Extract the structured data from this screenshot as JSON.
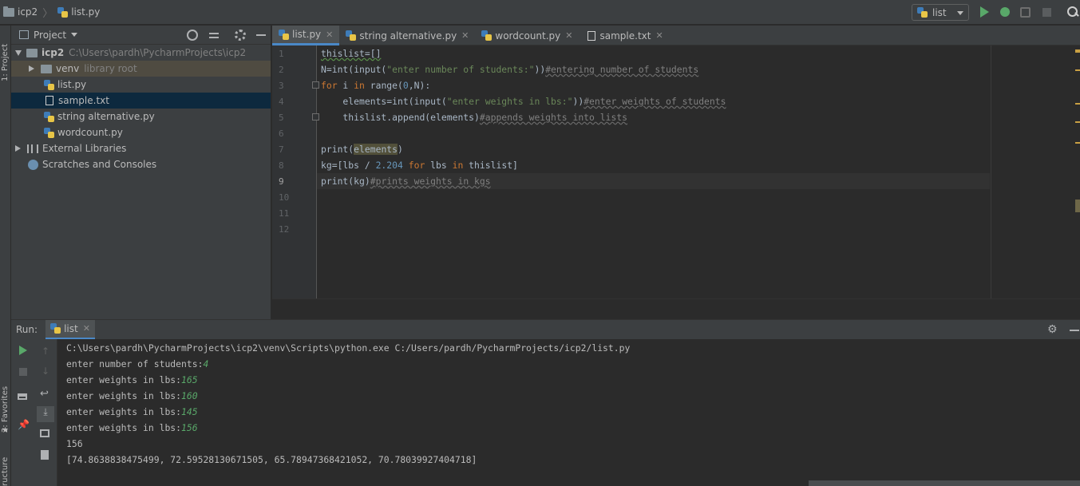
{
  "breadcrumb": {
    "project": "icp2",
    "file": "list.py"
  },
  "run_config": {
    "label": "list"
  },
  "colors": {
    "accent": "#4a88c7",
    "run_green": "#59a869",
    "keyword": "#cc7832",
    "string": "#6a8759",
    "number": "#6897bb",
    "comment": "#808080"
  },
  "left_strip": {
    "project_label": "1: Project",
    "favorites_label": "2: Favorites",
    "structure_label": "ructure"
  },
  "project_panel": {
    "title": "Project",
    "root": {
      "name": "icp2",
      "path": "C:\\Users\\pardh\\PycharmProjects\\icp2"
    },
    "venv": {
      "name": "venv",
      "hint": "library root"
    },
    "files": [
      "list.py",
      "sample.txt",
      "string alternative.py",
      "wordcount.py"
    ],
    "external": "External Libraries",
    "scratches": "Scratches and Consoles"
  },
  "editor_tabs": [
    {
      "label": "list.py",
      "icon": "python-file-icon"
    },
    {
      "label": "string alternative.py",
      "icon": "python-file-icon"
    },
    {
      "label": "wordcount.py",
      "icon": "python-file-icon"
    },
    {
      "label": "sample.txt",
      "icon": "text-file-icon"
    }
  ],
  "editor": {
    "line_numbers": [
      "1",
      "2",
      "3",
      "4",
      "5",
      "6",
      "7",
      "8",
      "9",
      "10",
      "11",
      "12"
    ],
    "current_line": 9,
    "code": [
      "thislist=[]",
      "N=int(input(\"enter number of students:\"))#entering number of students",
      "for i in range(0,N):",
      "    elements=int(input(\"enter weights in lbs:\"))#enter weights of students",
      "    thislist.append(elements)#appends weights into lists",
      "",
      "print(elements)",
      "kg=[lbs / 2.204 for lbs in thislist]",
      "print(kg)#prints weights in kgs"
    ]
  },
  "run_panel": {
    "label": "Run:",
    "tab": "list",
    "output": [
      {
        "text": "C:\\Users\\pardh\\PycharmProjects\\icp2\\venv\\Scripts\\python.exe C:/Users/pardh/PycharmProjects/icp2/list.py",
        "input": ""
      },
      {
        "text": "enter number of students:",
        "input": "4"
      },
      {
        "text": "enter weights in lbs:",
        "input": "165"
      },
      {
        "text": "enter weights in lbs:",
        "input": "160"
      },
      {
        "text": "enter weights in lbs:",
        "input": "145"
      },
      {
        "text": "enter weights in lbs:",
        "input": "156"
      },
      {
        "text": "156",
        "input": ""
      },
      {
        "text": "[74.8638838475499, 72.59528130671505, 65.78947368421052, 70.78039927404718]",
        "input": ""
      }
    ]
  }
}
